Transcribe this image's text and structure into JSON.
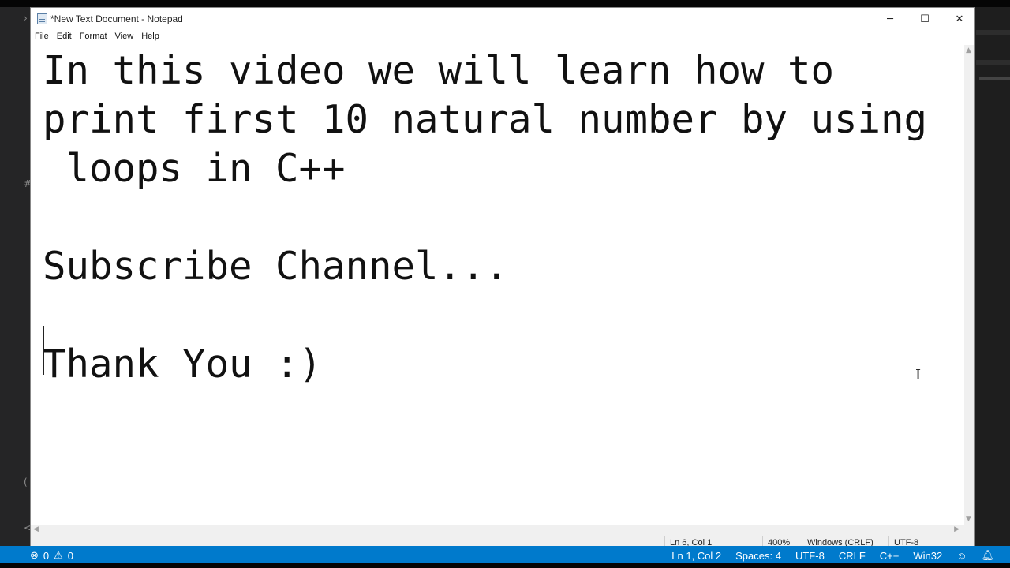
{
  "window": {
    "title": "*New Text Document - Notepad",
    "minimize_label": "─",
    "maximize_label": "☐",
    "close_label": "✕"
  },
  "menu": {
    "items": [
      {
        "label": "File"
      },
      {
        "label": "Edit"
      },
      {
        "label": "Format"
      },
      {
        "label": "View"
      },
      {
        "label": "Help"
      }
    ]
  },
  "editor": {
    "lines": [
      "In this video we will learn how to",
      "print first 10 natural number by using",
      " loops in C++",
      "",
      "Subscribe Channel...",
      "",
      "Thank You :)"
    ],
    "caret_line": 6,
    "caret_col": 2
  },
  "status": {
    "position": "Ln 6, Col 1",
    "zoom": "400%",
    "line_ending": "Windows (CRLF)",
    "encoding": "UTF-8"
  },
  "vscode_status": {
    "errors": "0",
    "warnings": "0",
    "position": "Ln 1, Col 2",
    "spaces": "Spaces: 4",
    "encoding": "UTF-8",
    "eol": "CRLF",
    "language": "C++",
    "platform": "Win32"
  },
  "colors": {
    "vscode_status_bg": "#007acc",
    "notepad_bg": "#ffffff",
    "editor_text": "#111111"
  }
}
